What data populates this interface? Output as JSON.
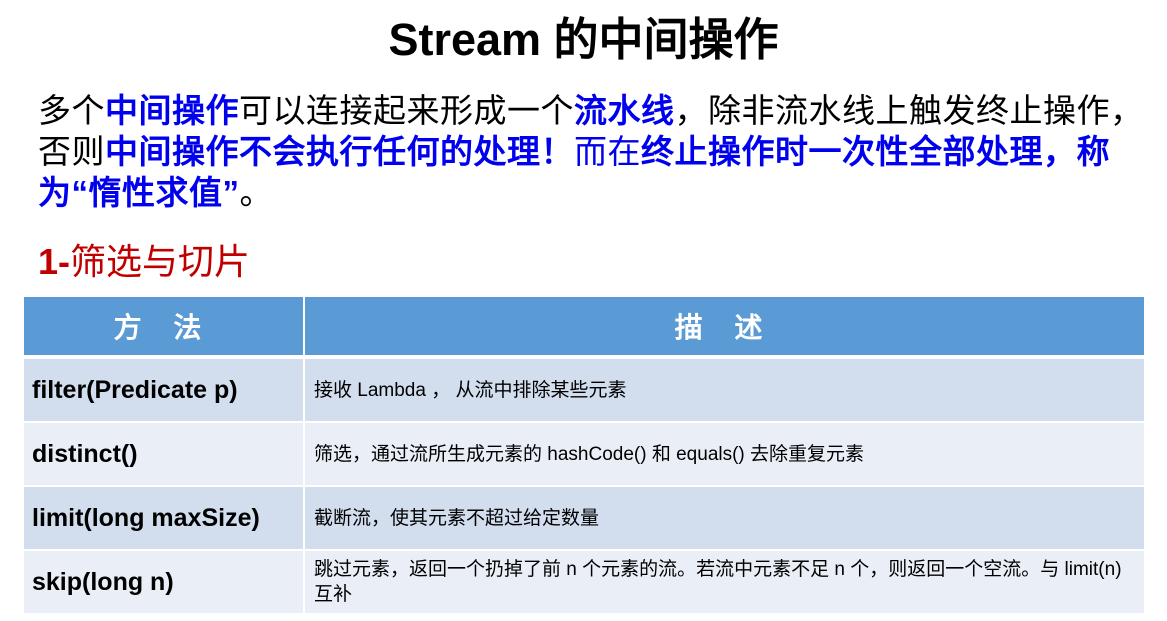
{
  "title": "Stream 的中间操作",
  "paragraph": [
    {
      "text": "多个",
      "style": "plain"
    },
    {
      "text": "中间操作",
      "style": "blue-bold"
    },
    {
      "text": "可以连接起来形成一个",
      "style": "plain"
    },
    {
      "text": "流水线",
      "style": "blue-bold"
    },
    {
      "text": "，除非流水线上触发终止操作，否则",
      "style": "plain"
    },
    {
      "text": "中间操作不会执行任何的处理！",
      "style": "blue-bold"
    },
    {
      "text": "而在",
      "style": "blue"
    },
    {
      "text": "终止操作时一次性全部处理，称为“惰性求值”",
      "style": "blue-bold"
    },
    {
      "text": "。",
      "style": "plain"
    }
  ],
  "section": {
    "number": "1-",
    "title": "筛选与切片"
  },
  "table": {
    "headers": {
      "method": "方 法",
      "description": "描 述"
    },
    "rows": [
      {
        "method": "filter(Predicate p)",
        "description": "接收 Lambda ， 从流中排除某些元素"
      },
      {
        "method": "distinct()",
        "description": "筛选，通过流所生成元素的 hashCode() 和 equals() 去除重复元素"
      },
      {
        "method": "limit(long maxSize)",
        "description": "截断流，使其元素不超过给定数量"
      },
      {
        "method": "skip(long n)",
        "description": "跳过元素，返回一个扔掉了前 n 个元素的流。若流中元素不足 n 个，则返回一个空流。与 limit(n) 互补"
      }
    ]
  },
  "colors": {
    "header_bg": "#5b9bd5",
    "row_odd": "#d2ddee",
    "row_even": "#e9eef7",
    "highlight_text": "#0000ee",
    "section_text": "#c00000"
  }
}
